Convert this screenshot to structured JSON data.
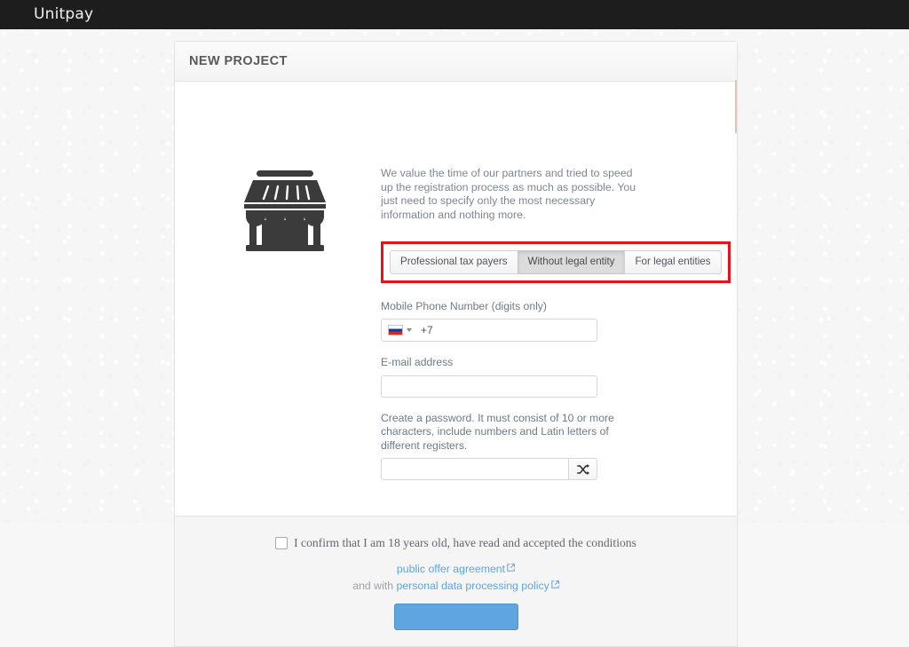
{
  "topbar": {
    "brand": "Unitpay"
  },
  "card": {
    "title": "NEW PROJECT",
    "illustration_icon": "storefront-icon",
    "intro": "We value the time of our partners and tried to speed up the registration process as much as possible. You just need to specify only the most necessary information and nothing more.",
    "tabs": [
      {
        "label": "Professional tax payers",
        "active": false
      },
      {
        "label": "Without legal entity",
        "active": true
      },
      {
        "label": "For legal entities",
        "active": false
      }
    ],
    "highlight_color": "#e8121a",
    "fields": {
      "phone": {
        "label": "Mobile Phone Number (digits only)",
        "country_flag": "flag-ru-icon",
        "country_caret": "chevron-down-icon",
        "value": "+7",
        "placeholder": ""
      },
      "email": {
        "label": "E-mail address",
        "value": "",
        "placeholder": ""
      },
      "password": {
        "label": "Create a password. It must consist of 10 or more characters, include numbers and Latin letters of different registers.",
        "value": "",
        "placeholder": "",
        "generate_icon": "shuffle-icon"
      }
    }
  },
  "footer": {
    "confirm_text": "I confirm that I am 18 years old, have read and accepted the conditions",
    "checkbox_checked": false,
    "offer_link": "public offer agreement",
    "and_with": "and with",
    "privacy_link": "personal data processing policy",
    "external_icon": "external-link-icon",
    "submit_label": "",
    "submit_color": "#5fa5e0"
  }
}
